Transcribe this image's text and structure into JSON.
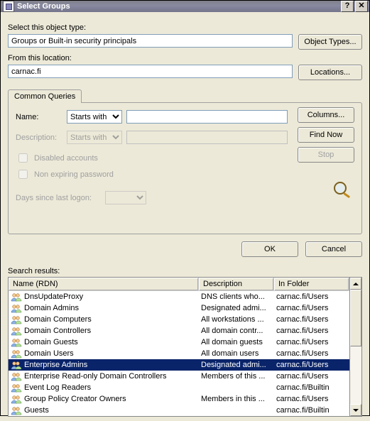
{
  "window": {
    "title": "Select Groups"
  },
  "objectType": {
    "label": "Select this object type:",
    "value": "Groups or Built-in security principals",
    "button": "Object Types..."
  },
  "location": {
    "label": "From this location:",
    "value": "carnac.fi",
    "button": "Locations..."
  },
  "queries": {
    "tab": "Common Queries",
    "nameLabel": "Name:",
    "nameOp": "Starts with",
    "nameValue": "",
    "descLabel": "Description:",
    "descOp": "Starts with",
    "descValue": "",
    "cbDisabled": "Disabled accounts",
    "cbNonExpiring": "Non expiring password",
    "daysLabel": "Days since last logon:",
    "daysValue": "",
    "buttons": {
      "columns": "Columns...",
      "findNow": "Find Now",
      "stop": "Stop"
    }
  },
  "actions": {
    "ok": "OK",
    "cancel": "Cancel"
  },
  "results": {
    "label": "Search results:",
    "columns": [
      "Name (RDN)",
      "Description",
      "In Folder"
    ],
    "rows": [
      {
        "name": "DnsUpdateProxy",
        "desc": "DNS clients who...",
        "folder": "carnac.fi/Users",
        "selected": false
      },
      {
        "name": "Domain Admins",
        "desc": "Designated admi...",
        "folder": "carnac.fi/Users",
        "selected": false
      },
      {
        "name": "Domain Computers",
        "desc": "All workstations ...",
        "folder": "carnac.fi/Users",
        "selected": false
      },
      {
        "name": "Domain Controllers",
        "desc": "All domain contr...",
        "folder": "carnac.fi/Users",
        "selected": false
      },
      {
        "name": "Domain Guests",
        "desc": "All domain guests",
        "folder": "carnac.fi/Users",
        "selected": false
      },
      {
        "name": "Domain Users",
        "desc": "All domain users",
        "folder": "carnac.fi/Users",
        "selected": false
      },
      {
        "name": "Enterprise Admins",
        "desc": "Designated admi...",
        "folder": "carnac.fi/Users",
        "selected": true
      },
      {
        "name": "Enterprise Read-only Domain Controllers",
        "desc": "Members of this ...",
        "folder": "carnac.fi/Users",
        "selected": false
      },
      {
        "name": "Event Log Readers",
        "desc": "",
        "folder": "carnac.fi/Builtin",
        "selected": false
      },
      {
        "name": "Group Policy Creator Owners",
        "desc": "Members in this ...",
        "folder": "carnac.fi/Users",
        "selected": false
      },
      {
        "name": "Guests",
        "desc": "",
        "folder": "carnac.fi/Builtin",
        "selected": false
      }
    ]
  }
}
